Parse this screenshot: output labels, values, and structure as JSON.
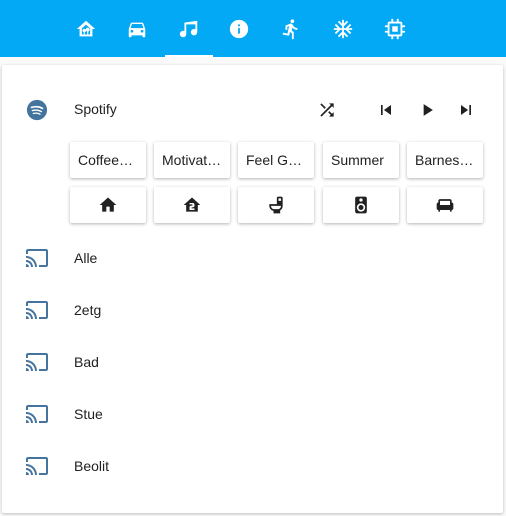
{
  "tabs": [
    {
      "icon": "home-assistant-icon"
    },
    {
      "icon": "car-icon"
    },
    {
      "icon": "music-note-icon",
      "active": true
    },
    {
      "icon": "info-icon"
    },
    {
      "icon": "run-icon"
    },
    {
      "icon": "snowflake-icon"
    },
    {
      "icon": "chip-icon"
    }
  ],
  "spotify": {
    "title": "Spotify",
    "controls": [
      "shuffle-icon",
      "skip-previous-icon",
      "play-icon",
      "skip-next-icon"
    ],
    "playlists": [
      "Coffeehouse",
      "Motivation",
      "Feel Good",
      "Summer",
      "Barnesanger"
    ],
    "rooms": [
      "home-icon",
      "home-floor-2-icon",
      "toilet-icon",
      "speaker-icon",
      "sofa-icon"
    ]
  },
  "cast_devices": [
    {
      "name": "Alle"
    },
    {
      "name": "2etg"
    },
    {
      "name": "Bad"
    },
    {
      "name": "Stue"
    },
    {
      "name": "Beolit"
    }
  ],
  "colors": {
    "header": "#03a9f4",
    "cast_icon": "#44739e",
    "spotify_icon": "#44739e"
  }
}
